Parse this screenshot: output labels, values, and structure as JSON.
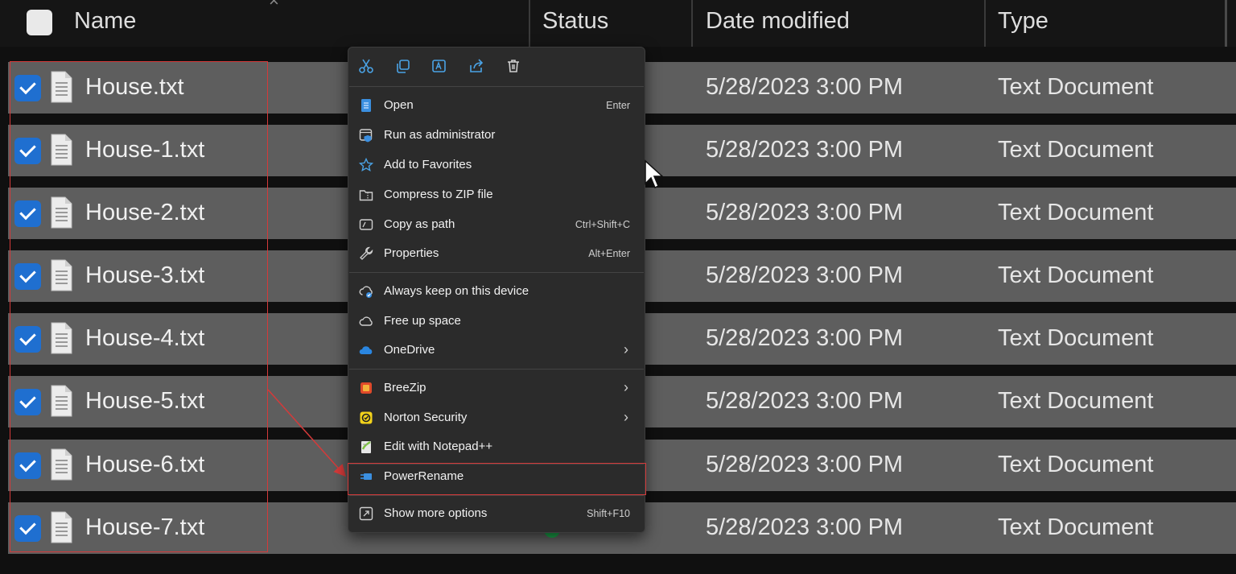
{
  "header": {
    "columns": [
      "Name",
      "Status",
      "Date modified",
      "Type"
    ]
  },
  "files": [
    {
      "name": "House.txt",
      "date": "5/28/2023 3:00 PM",
      "type": "Text Document"
    },
    {
      "name": "House-1.txt",
      "date": "5/28/2023 3:00 PM",
      "type": "Text Document"
    },
    {
      "name": "House-2.txt",
      "date": "5/28/2023 3:00 PM",
      "type": "Text Document"
    },
    {
      "name": "House-3.txt",
      "date": "5/28/2023 3:00 PM",
      "type": "Text Document"
    },
    {
      "name": "House-4.txt",
      "date": "5/28/2023 3:00 PM",
      "type": "Text Document"
    },
    {
      "name": "House-5.txt",
      "date": "5/28/2023 3:00 PM",
      "type": "Text Document"
    },
    {
      "name": "House-6.txt",
      "date": "5/28/2023 3:00 PM",
      "type": "Text Document"
    },
    {
      "name": "House-7.txt",
      "date": "5/28/2023 3:00 PM",
      "type": "Text Document"
    }
  ],
  "context_menu": {
    "toolbar": [
      "cut-icon",
      "copy-icon",
      "rename-icon",
      "share-icon",
      "delete-icon"
    ],
    "items": [
      {
        "label": "Open",
        "shortcut": "Enter",
        "icon": "open-icon"
      },
      {
        "label": "Run as administrator",
        "shortcut": "",
        "icon": "admin-icon"
      },
      {
        "label": "Add to Favorites",
        "shortcut": "",
        "icon": "star-icon"
      },
      {
        "label": "Compress to ZIP file",
        "shortcut": "",
        "icon": "zip-icon"
      },
      {
        "label": "Copy as path",
        "shortcut": "Ctrl+Shift+C",
        "icon": "path-icon"
      },
      {
        "label": "Properties",
        "shortcut": "Alt+Enter",
        "icon": "wrench-icon"
      },
      {
        "label": "Always keep on this device",
        "shortcut": "",
        "icon": "cloud-sync-icon"
      },
      {
        "label": "Free up space",
        "shortcut": "",
        "icon": "cloud-icon"
      },
      {
        "label": "OneDrive",
        "shortcut": "",
        "icon": "onedrive-icon",
        "submenu": true
      },
      {
        "label": "BreeZip",
        "shortcut": "",
        "icon": "breezip-icon",
        "submenu": true
      },
      {
        "label": "Norton Security",
        "shortcut": "",
        "icon": "norton-icon",
        "submenu": true
      },
      {
        "label": "Edit with Notepad++",
        "shortcut": "",
        "icon": "notepad-plus-plus-icon"
      },
      {
        "label": "PowerRename",
        "shortcut": "",
        "icon": "powerrename-icon"
      },
      {
        "label": "Show more options",
        "shortcut": "Shift+F10",
        "icon": "more-options-icon"
      }
    ]
  },
  "colors": {
    "accent": "#1f6fd0",
    "highlight": "#d43a3a",
    "menu_bg": "#2b2b2b",
    "row_bg": "#5e5e5e"
  }
}
